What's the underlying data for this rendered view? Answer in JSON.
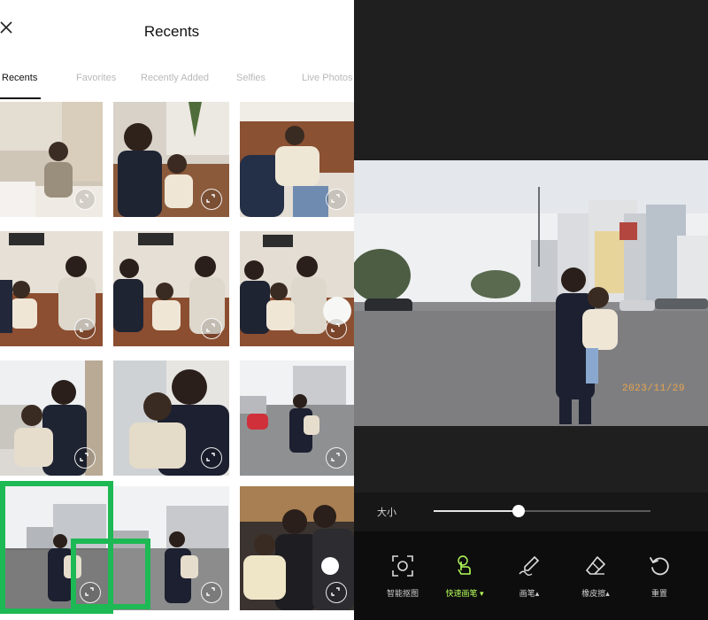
{
  "picker": {
    "title": "Recents",
    "close_icon": "close-icon",
    "tabs": [
      {
        "label": "Recents",
        "active": true
      },
      {
        "label": "Favorites",
        "active": false
      },
      {
        "label": "Recently Added",
        "active": false
      },
      {
        "label": "Selfies",
        "active": false
      },
      {
        "label": "Live Photos",
        "active": false
      }
    ],
    "selected_index": 9
  },
  "editor": {
    "date_stamp": "2023/11/29",
    "size_label": "大小",
    "size_value": 0.39,
    "tools": [
      {
        "label": "智能抠图",
        "icon": "smart-cutout-icon",
        "active": false
      },
      {
        "label": "快速画笔",
        "icon": "tap-hand-icon",
        "active": true
      },
      {
        "label": "画笔",
        "icon": "brush-icon",
        "active": false
      },
      {
        "label": "橡皮擦",
        "icon": "eraser-icon",
        "active": false
      },
      {
        "label": "重置",
        "icon": "reset-icon",
        "active": false
      }
    ]
  },
  "colors": {
    "highlight": "#1db954",
    "active_tool_label": "#b5ff5a",
    "date_stamp": "#e8a54e"
  }
}
